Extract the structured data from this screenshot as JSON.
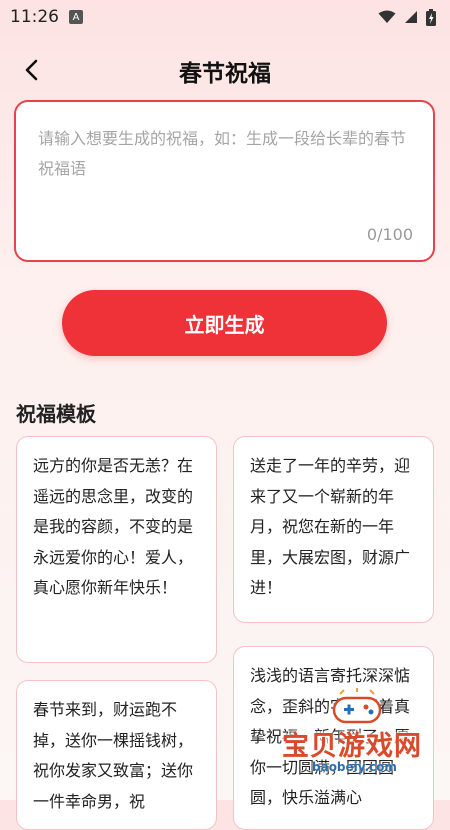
{
  "status_bar": {
    "time": "11:26",
    "notification_badge": "A"
  },
  "header": {
    "title": "春节祝福"
  },
  "input": {
    "placeholder": "请输入想要生成的祝福，如：生成一段给长辈的春节祝福语",
    "value": "",
    "char_count": "0/100"
  },
  "generate_button": {
    "label": "立即生成"
  },
  "templates": {
    "title": "祝福模板",
    "cards": [
      "远方的你是否无恙？在遥远的思念里，改变的是我的容颜，不变的是永远爱你的心！爱人，真心愿你新年快乐！",
      "送走了一年的辛劳，迎来了又一个崭新的年月，祝您在新的一年里，大展宏图，财源广进！",
      "春节来到，财运跑不掉，送你一棵摇钱树，祝你发家又致富；送你一件幸命男，祝",
      "浅浅的语言寄托深深惦念，歪斜的字里写着真挚祝福，新年到了，愿你一切圆满，团团圆圆，快乐溢满心"
    ]
  },
  "watermark": {
    "text": "宝贝游戏网",
    "url": "baobeiy.com"
  },
  "colors": {
    "accent": "#ef3138",
    "border": "#e8424a",
    "card_border": "#f3c3c5"
  }
}
